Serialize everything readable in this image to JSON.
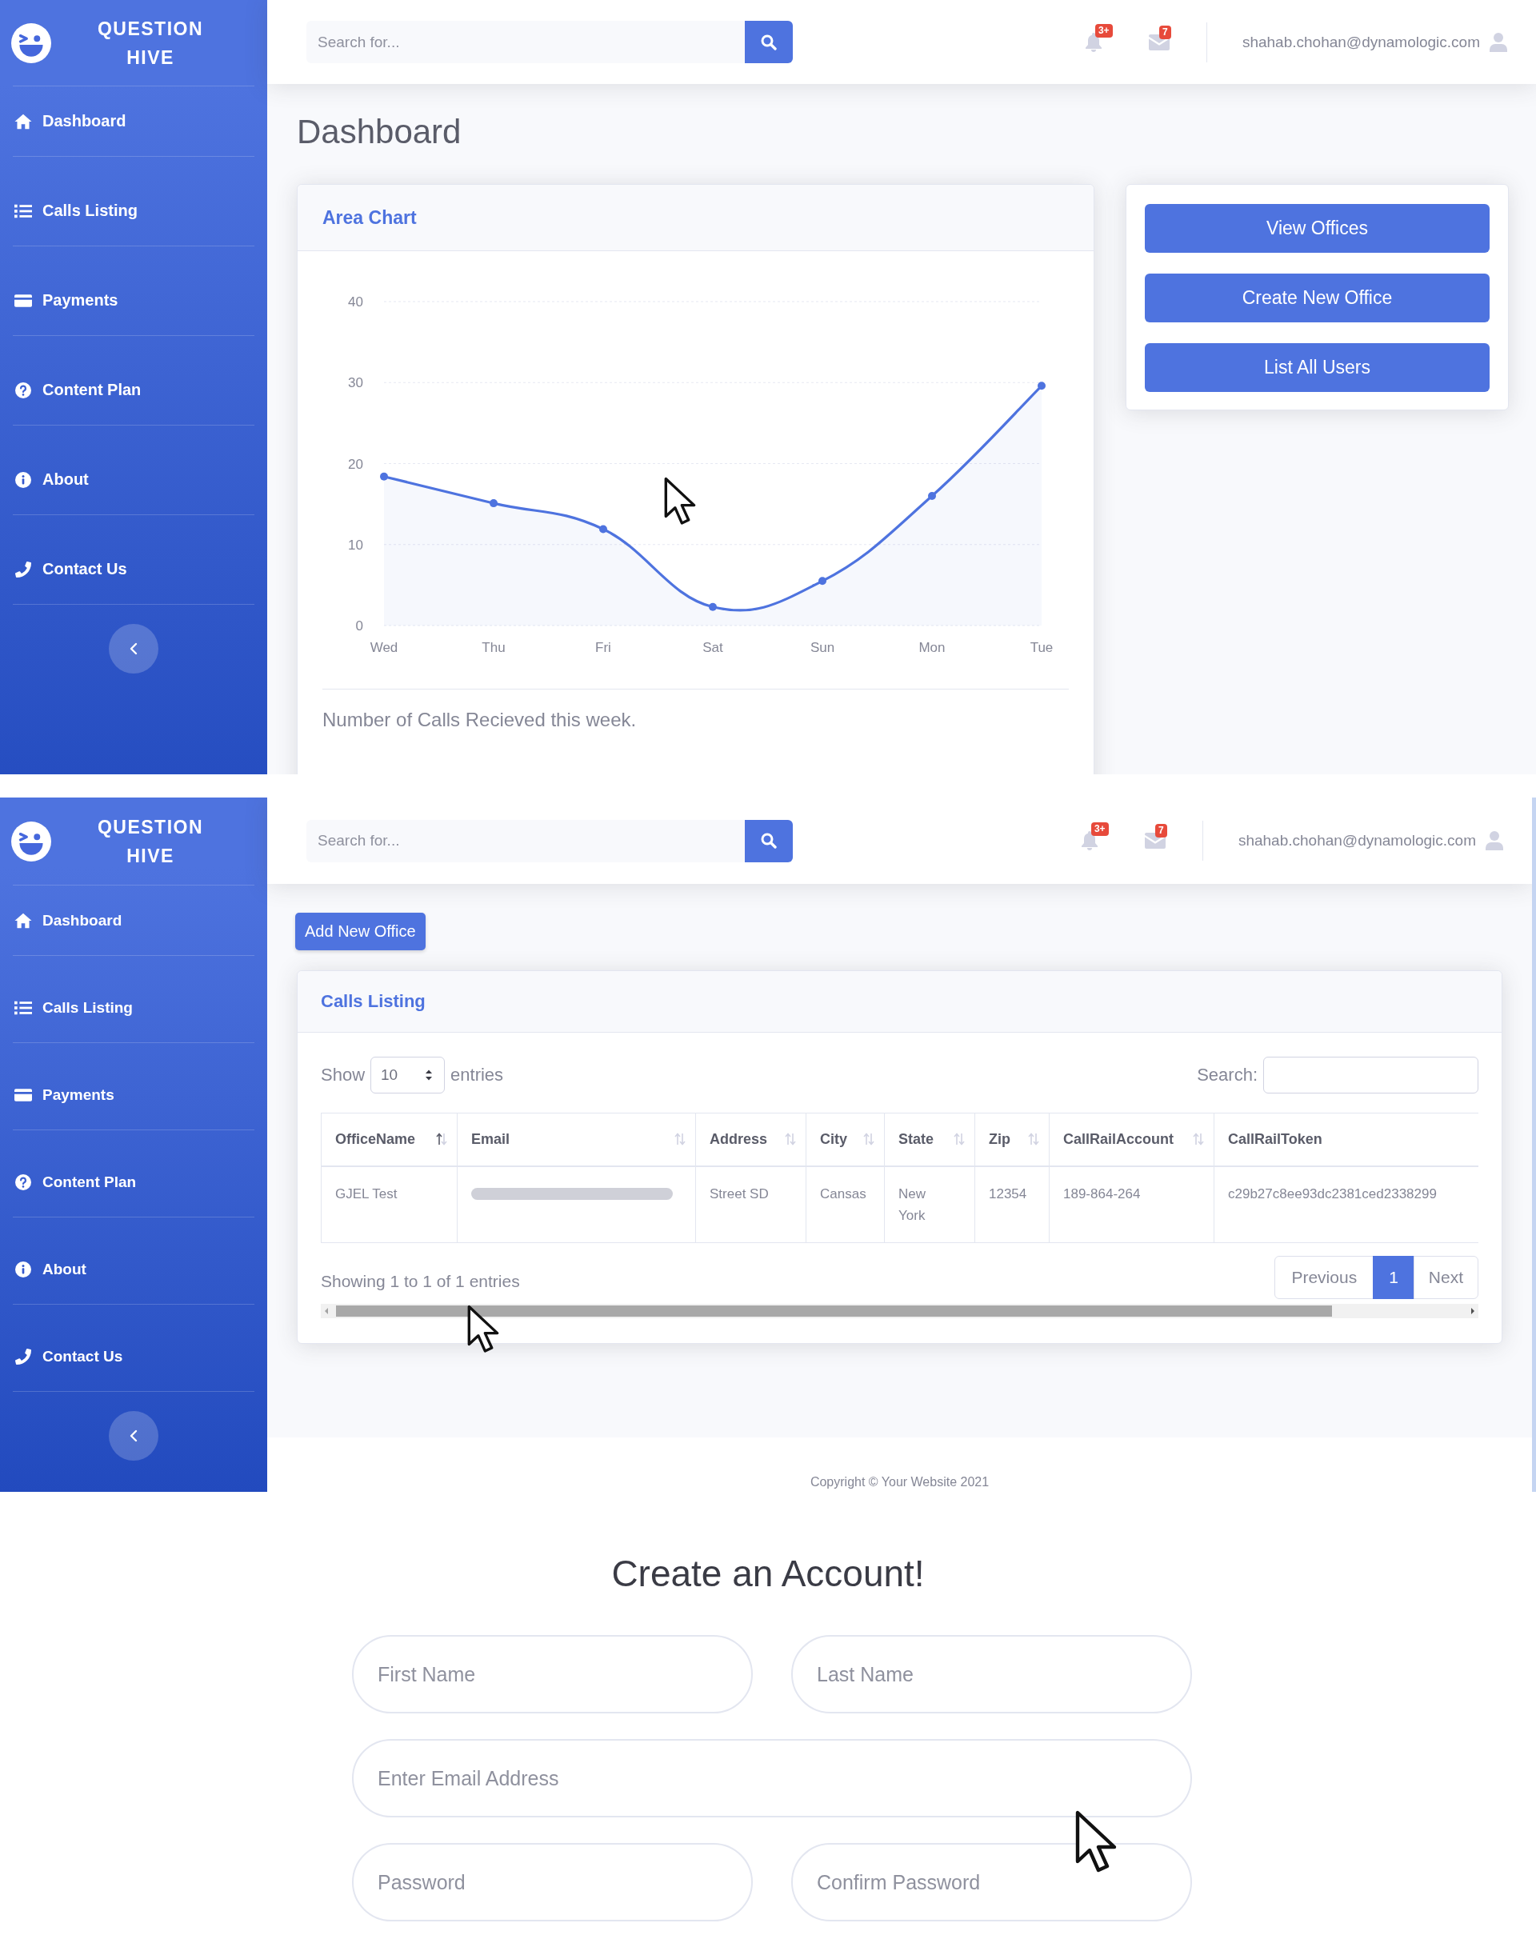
{
  "dashboard_screen": {
    "sidebar": {
      "brand": "QUESTION HIVE",
      "items": [
        "Dashboard",
        "Calls Listing",
        "Payments",
        "Content Plan",
        "About",
        "Contact Us"
      ]
    },
    "topbar": {
      "search": {
        "placeholder": "Search for..."
      },
      "alerts_badge": "3+",
      "messages_badge": "7",
      "user_email": "shahab.chohan@dynamologic.com"
    },
    "page_title": "Dashboard",
    "chart_card": {
      "title": "Area Chart",
      "chart_data": {
        "type": "area",
        "categories": [
          "Wed",
          "Thu",
          "Fri",
          "Sat",
          "Sun",
          "Mon",
          "Tue"
        ],
        "series": [
          {
            "color": "#4e73df",
            "values": [
              18.4,
              15.1,
              11.9,
              2.3,
              5.5,
              16,
              29.6
            ]
          }
        ],
        "ylim": [
          0,
          40
        ],
        "yticks": [
          0,
          10,
          20,
          30,
          40
        ],
        "grid": true
      },
      "caption": "Number of Calls Recieved this week."
    },
    "action_buttons": [
      "View Offices",
      "Create New Office",
      "List All Users"
    ]
  },
  "calls_listing_screen": {
    "sidebar": {
      "brand": "QUESTION HIVE",
      "items": [
        "Dashboard",
        "Calls Listing",
        "Payments",
        "Content Plan",
        "About",
        "Contact Us"
      ]
    },
    "topbar": {
      "search": {
        "placeholder": "Search for..."
      },
      "alerts_badge": "3+",
      "messages_badge": "7",
      "user_email": "shahab.chohan@dynamologic.com"
    },
    "add_button": "Add New Office",
    "listing_card": {
      "title": "Calls Listing",
      "length_menu": {
        "label_before": "Show",
        "value": "10",
        "label_after": "entries"
      },
      "search_label": "Search:",
      "table": {
        "columns": [
          {
            "label": "OfficeName",
            "sorted": true
          },
          {
            "label": "Email",
            "sorted": false
          },
          {
            "label": "Address",
            "sorted": false
          },
          {
            "label": "City",
            "sorted": false
          },
          {
            "label": "State",
            "sorted": false
          },
          {
            "label": "Zip",
            "sorted": false
          },
          {
            "label": "CallRailAccount",
            "sorted": false
          },
          {
            "label": "CallRailToken"
          }
        ],
        "rows": [
          {
            "cells": [
              {
                "text": "GJEL Test",
                "blurred": false
              },
              {
                "blurred": true
              },
              {
                "text": "Street SD",
                "blurred": false
              },
              {
                "text": "Cansas",
                "blurred": false
              },
              {
                "text": "New York",
                "blurred": false
              },
              {
                "text": "12354",
                "blurred": false
              },
              {
                "text": "189-864-264",
                "blurred": false
              },
              {
                "text": "c29b27c8ee93dc2381ced2338299",
                "blurred": false
              }
            ]
          }
        ]
      },
      "info": "Showing 1 to 1 of 1 entries",
      "pagination": [
        {
          "label": "Previous",
          "selected": false
        },
        {
          "label": "1",
          "selected": true
        },
        {
          "label": "Next",
          "selected": false
        }
      ]
    },
    "footer": "Copyright © Your Website 2021"
  },
  "signup_screen": {
    "title": "Create an Account!",
    "field_rows": [
      [
        {
          "placeholder": "First Name"
        },
        {
          "placeholder": "Last Name"
        }
      ],
      [
        {
          "placeholder": "Enter Email Address"
        }
      ],
      [
        {
          "placeholder": "Password"
        },
        {
          "placeholder": "Confirm Password"
        }
      ]
    ]
  }
}
